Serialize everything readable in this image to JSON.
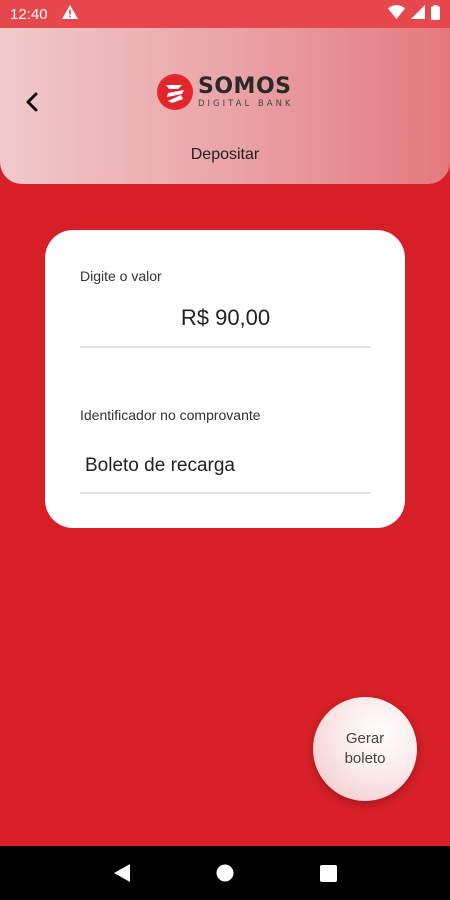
{
  "status_bar": {
    "time": "12:40",
    "icons": [
      "warning-icon",
      "wifi-icon",
      "signal-icon",
      "battery-icon"
    ]
  },
  "header": {
    "logo_name": "SOMOS",
    "logo_subtitle": "DIGITAL BANK",
    "title": "Depositar",
    "back_icon": "chevron-left-icon"
  },
  "form": {
    "amount_label": "Digite o valor",
    "amount_value": "R$ 90,00",
    "identifier_label": "Identificador no comprovante",
    "identifier_value": "Boleto de recarga"
  },
  "fab": {
    "label_line1": "Gerar",
    "label_line2": "boleto"
  },
  "nav": {
    "buttons": [
      "back-triangle-icon",
      "home-circle-icon",
      "recents-square-icon"
    ]
  },
  "colors": {
    "background": "#d61f26",
    "brand_red": "#e2262d",
    "status_bar": "#e5474d"
  }
}
